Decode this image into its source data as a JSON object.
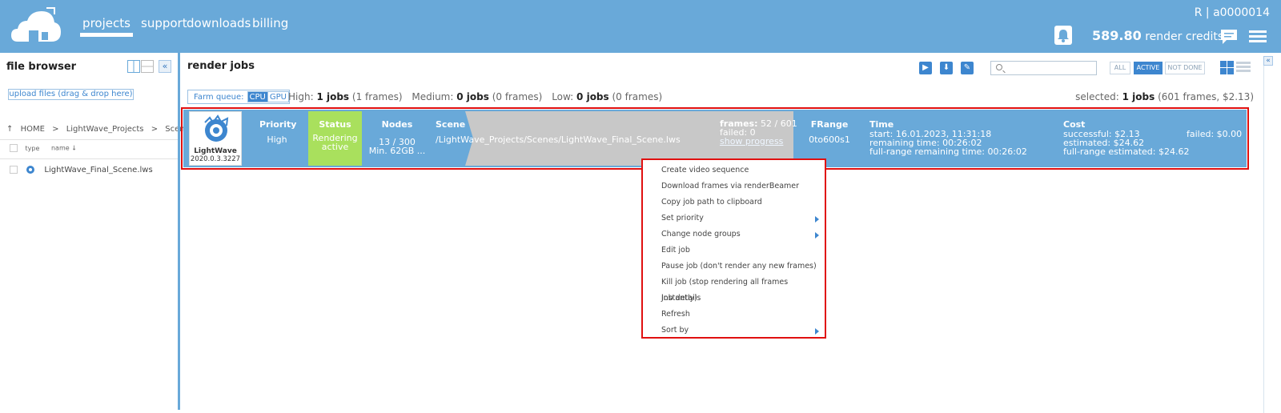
{
  "header": {
    "nav": [
      {
        "label": "projects",
        "active": true
      },
      {
        "label": "support",
        "active": false
      },
      {
        "label": "downloads",
        "active": false
      },
      {
        "label": "billing",
        "active": false
      }
    ],
    "user": "R | a0000014",
    "credits_value": "589.80",
    "credits_label": "render credits",
    "icons": [
      "cloud-logo",
      "bell-icon",
      "chat-icon",
      "menu-icon"
    ],
    "accent_color": "#69a9d9"
  },
  "file_browser": {
    "title": "file browser",
    "upload_label": "upload files (drag & drop here)",
    "breadcrumb": [
      "HOME",
      ">",
      "LightWave_Projects",
      ">",
      "Scenes"
    ],
    "columns": {
      "type": "type",
      "name": "name ↓"
    },
    "files": [
      {
        "name": "LightWave_Final_Scene.lws"
      }
    ]
  },
  "render_jobs": {
    "title": "render jobs",
    "search_placeholder": "",
    "filters": [
      {
        "label": "ALL",
        "active": false
      },
      {
        "label": "ACTIVE",
        "active": true
      },
      {
        "label": "NOT DONE",
        "active": false
      }
    ],
    "farm_queue": {
      "label": "Farm queue:",
      "options": [
        "CPU",
        "GPU"
      ],
      "selected": "CPU"
    },
    "stats": {
      "high_label": "High:",
      "high_jobs": "1 jobs",
      "high_frames": "(1 frames)",
      "medium_label": "Medium:",
      "medium_jobs": "0 jobs",
      "medium_frames": "(0 frames)",
      "low_label": "Low:",
      "low_jobs": "0 jobs",
      "low_frames": "(0 frames)"
    },
    "selected": {
      "label": "selected:",
      "jobs": "1 jobs",
      "details": "(601 frames, $2.13)"
    }
  },
  "job": {
    "software": "LightWave",
    "version": "2020.0.3.3227",
    "priority_header": "Priority",
    "priority": "High",
    "status_header": "Status",
    "status_line1": "Rendering",
    "status_line2": "active",
    "status_color": "#a9e05d",
    "nodes_header": "Nodes",
    "nodes": "13 / 300",
    "nodes_min": "Min. 62GB ...",
    "scene_header": "Scene",
    "scene_path": "/LightWave_Projects/Scenes/LightWave_Final_Scene.lws",
    "frames_label": "frames:",
    "frames_value": "52 / 601",
    "failed": "failed: 0",
    "show_progress": "show progress",
    "frange_header": "FRange",
    "frange": "0to600s1",
    "time_header": "Time",
    "time_start": "start: 16.01.2023, 11:31:18",
    "time_remaining": "remaining time: 00:26:02",
    "time_full_remaining": "full-range remaining time: 00:26:02",
    "cost_header": "Cost",
    "cost_successful": "successful: $2.13",
    "cost_estimated": "estimated: $24.62",
    "cost_full_estimated": "full-range estimated: $24.62",
    "cost_failed": "failed: $0.00"
  },
  "context_menu": {
    "items": [
      {
        "label": "Create video sequence",
        "submenu": false
      },
      {
        "label": "Download frames via renderBeamer",
        "submenu": false
      },
      {
        "label": "Copy job path to clipboard",
        "submenu": false
      },
      {
        "label": "Set priority",
        "submenu": true
      },
      {
        "label": "Change node groups",
        "submenu": true
      },
      {
        "label": "Edit job",
        "submenu": false
      },
      {
        "label": "Pause job (don't render any new frames)",
        "submenu": false
      },
      {
        "label": "Kill job (stop rendering all frames instantly)",
        "submenu": false
      },
      {
        "label": "Job details",
        "submenu": false
      },
      {
        "label": "Refresh",
        "submenu": false
      },
      {
        "label": "Sort by",
        "submenu": true
      }
    ]
  }
}
